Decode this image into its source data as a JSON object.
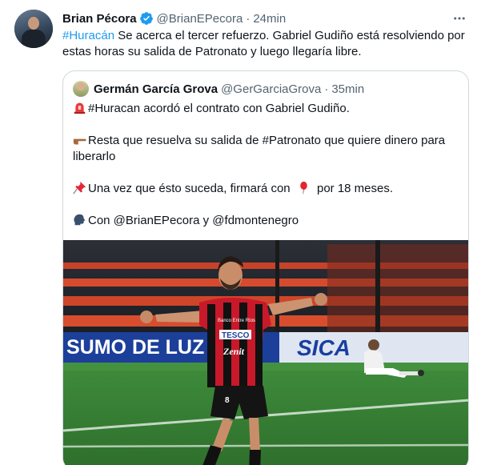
{
  "tweet": {
    "author_name": "Brian Pécora",
    "author_handle": "@BrianEPecora",
    "separator": "·",
    "time": "24min",
    "more_label": "•••",
    "hashtag": "#Huracán",
    "text_line1": " Se acerca el tercer refuerzo. Gabriel Gudiño está resolviendo por",
    "text_line2": "estas horas su salida de Patronato y luego llegaría libre."
  },
  "quote": {
    "author_name": "Germán García Grova",
    "author_handle": "@GerGarciaGrova",
    "separator": "·",
    "time": "35min",
    "line1": "#Huracan acordó el contrato con Gabriel Gudiño.",
    "line2": "Resta que resuelva su salida de #Patronato que quiere dinero para",
    "line3": "liberarlo",
    "line4a": "Una vez que ésto suceda, firmará con ",
    "line4b": " por 18 meses.",
    "line5": "Con @BrianEPecora y @fdmontenegro"
  },
  "photo": {
    "banner_left": "SUMO DE LUZ",
    "banner_right": "SICA",
    "shirt_sponsor": "TESCO",
    "shirt_sponsor2": "Zenit",
    "shirt_number": "8",
    "chest_text": "Banco Entre Ríos"
  }
}
